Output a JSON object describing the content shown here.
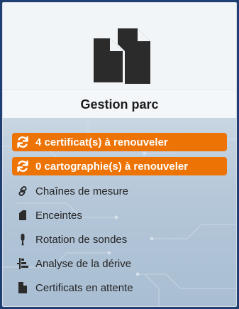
{
  "card": {
    "title": "Gestion parc",
    "header_icon": "copy-files-icon"
  },
  "alerts": [
    {
      "label": "4 certificat(s) à renouveler",
      "icon": "refresh-icon",
      "color": "#ee7305"
    },
    {
      "label": "0 cartographie(s) à renouveler",
      "icon": "refresh-icon",
      "color": "#ee7305"
    }
  ],
  "menu": [
    {
      "label": "Chaînes de mesure",
      "icon": "link-icon"
    },
    {
      "label": "Enceintes",
      "icon": "enclosure-icon"
    },
    {
      "label": "Rotation de sondes",
      "icon": "probe-icon"
    },
    {
      "label": "Analyse de la dérive",
      "icon": "drift-analysis-icon"
    },
    {
      "label": "Certificats en attente",
      "icon": "file-icon"
    }
  ]
}
